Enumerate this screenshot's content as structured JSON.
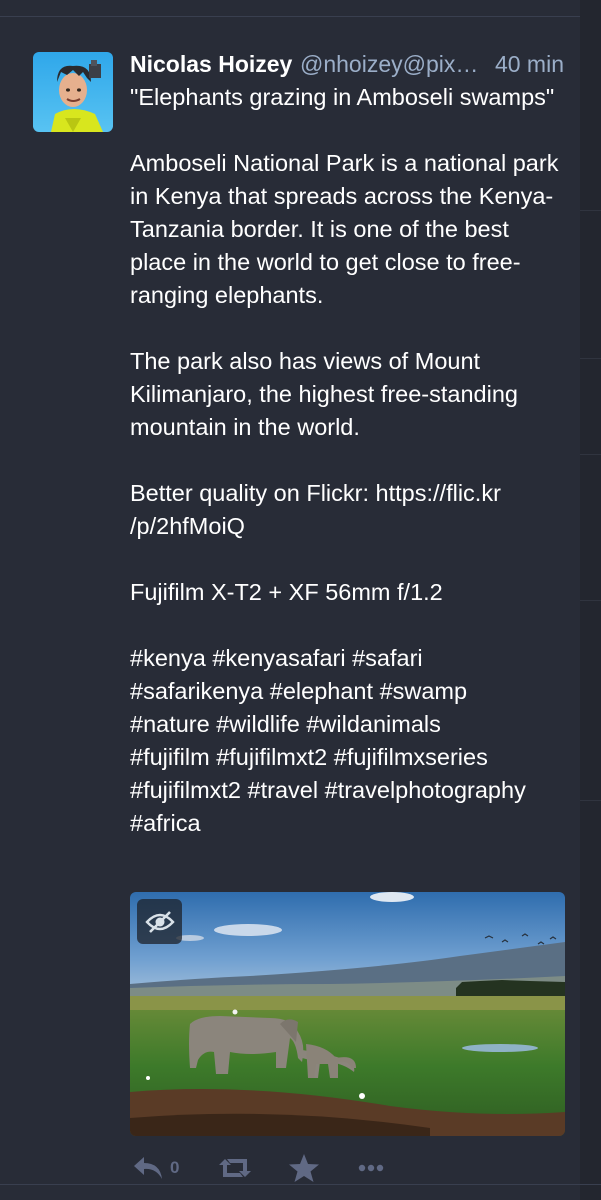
{
  "status": {
    "display_name": "Nicolas Hoizey",
    "account": "@nhoizey@pixel...",
    "time": "40 min",
    "paragraphs": [
      "\"Elephants grazing in Amboseli swamps\"",
      "Amboseli National Park is a national park in Kenya that spreads across the Kenya-Tanzania border. It is one of the best place in the world to get close to free-ranging elephants.",
      "The park also has views of Mount Kilimanjaro, the highest free-standing mountain in the world."
    ],
    "flickr_prefix": "Better quality on Flickr: ",
    "flickr_link_line1": "https://flic.kr",
    "flickr_link_line2": "/p/2hfMoiQ",
    "camera": "Fujifilm X-T2 + XF 56mm f/1.2",
    "hashtags": [
      "#kenya",
      "#kenyasafari",
      "#safari",
      "#safarikenya",
      "#elephant",
      "#swamp",
      "#nature",
      "#wildlife",
      "#wildanimals",
      "#fujifilm",
      "#fujifilmxt2",
      "#fujifilmxseries",
      "#fujifilmxt2",
      "#travel",
      "#travelphotography",
      "#africa"
    ],
    "hashtag_lines": [
      [
        0,
        1,
        2
      ],
      [
        3,
        4,
        5
      ],
      [
        6,
        7,
        8
      ],
      [
        9,
        10,
        11
      ],
      [
        12,
        13,
        14
      ],
      [
        15
      ]
    ]
  },
  "actions": {
    "reply_icon": "reply-icon",
    "reply_count": "0",
    "boost_icon": "boost-icon",
    "favourite_icon": "star-icon",
    "more_icon": "ellipsis-icon"
  },
  "media": {
    "hide_icon": "eye-slash-icon"
  },
  "colors": {
    "background": "#282c37",
    "secondary_text": "#9baec8",
    "action_icon": "#606984",
    "text": "#ffffff"
  }
}
